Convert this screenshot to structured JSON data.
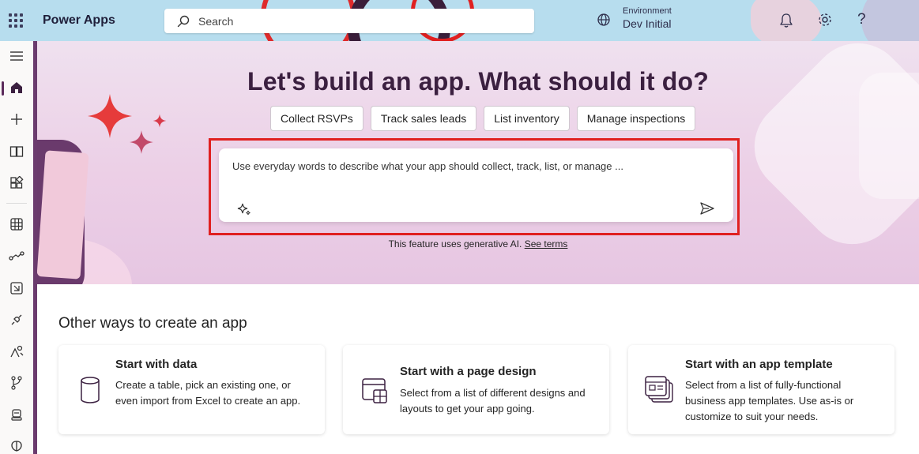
{
  "app": {
    "title": "Power Apps"
  },
  "search": {
    "placeholder": "Search"
  },
  "environment": {
    "label": "Environment",
    "value": "Dev Initial"
  },
  "icons": {
    "waffle": "waffle-icon",
    "search": "search-icon",
    "environment": "globe-icon",
    "notifications": "bell-icon",
    "settings": "gear-icon",
    "help": "question-icon"
  },
  "header_actions": {
    "help_glyph": "?"
  },
  "rail": {
    "items": [
      {
        "name": "menu",
        "icon": "hamburger-icon"
      },
      {
        "name": "home",
        "icon": "home-icon",
        "active": true
      },
      {
        "name": "create",
        "icon": "plus-icon"
      },
      {
        "name": "learn",
        "icon": "book-icon"
      },
      {
        "name": "apps",
        "icon": "apps-icon"
      },
      {
        "name": "tables",
        "icon": "table-icon"
      },
      {
        "name": "flows",
        "icon": "flow-icon"
      },
      {
        "name": "solutions",
        "icon": "solution-icon"
      },
      {
        "name": "connections",
        "icon": "plug-icon"
      },
      {
        "name": "ai-hub",
        "icon": "ai-icon"
      },
      {
        "name": "pipelines",
        "icon": "branch-icon"
      },
      {
        "name": "copilot-studio",
        "icon": "bot-icon"
      },
      {
        "name": "more",
        "icon": "brain-icon"
      }
    ]
  },
  "hero": {
    "headline": "Let's build an app. What should it do?",
    "chips": [
      "Collect RSVPs",
      "Track sales leads",
      "List inventory",
      "Manage inspections"
    ],
    "prompt_placeholder": "Use everyday words to describe what your app should collect, track, list, or manage ...",
    "notice_text": "This feature uses generative AI.",
    "notice_link": "See terms"
  },
  "other_ways": {
    "title": "Other ways to create an app",
    "cards": [
      {
        "title": "Start with data",
        "description": "Create a table, pick an existing one, or even import from Excel to create an app.",
        "icon": "database-icon"
      },
      {
        "title": "Start with a page design",
        "description": "Select from a list of different designs and layouts to get your app going.",
        "icon": "page-design-icon"
      },
      {
        "title": "Start with an app template",
        "description": "Select from a list of fully-functional business app templates. Use as-is or customize to suit your needs.",
        "icon": "template-icon"
      }
    ]
  },
  "colors": {
    "topbar": "#b7ddee",
    "accent": "#5b2b5b",
    "highlight_outline": "#e02020",
    "hero_bg": "#eccfe6"
  }
}
